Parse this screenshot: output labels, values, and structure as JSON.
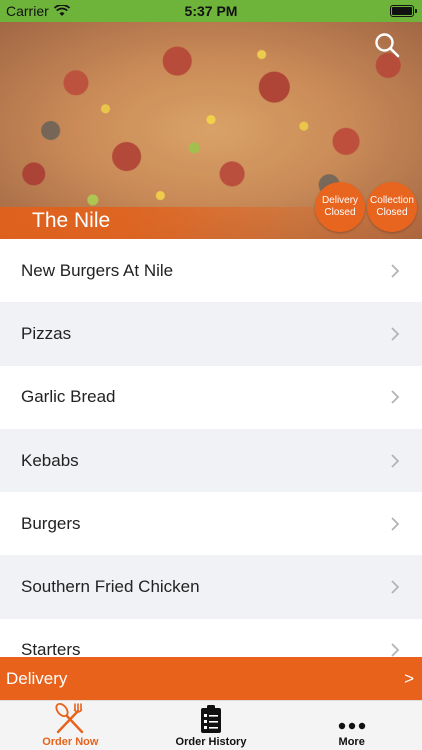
{
  "status_bar": {
    "carrier": "Carrier",
    "time": "5:37 PM",
    "battery_level": 1.0
  },
  "hero": {
    "restaurant_name": "The Nile",
    "delivery_badge": {
      "line1": "Delivery",
      "line2": "Closed"
    },
    "collection_badge": {
      "line1": "Collection",
      "line2": "Closed"
    }
  },
  "categories": [
    {
      "label": "New Burgers At Nile"
    },
    {
      "label": "Pizzas"
    },
    {
      "label": "Garlic Bread"
    },
    {
      "label": "Kebabs"
    },
    {
      "label": "Burgers"
    },
    {
      "label": "Southern Fried Chicken"
    },
    {
      "label": "Starters"
    }
  ],
  "delivery_bar": {
    "label": "Delivery",
    "arrow": ">"
  },
  "tab_bar": {
    "tabs": [
      {
        "label": "Order Now",
        "icon": "fork-knife-icon",
        "active": true
      },
      {
        "label": "Order History",
        "icon": "clipboard-icon",
        "active": false
      },
      {
        "label": "More",
        "icon": "more-dots-icon",
        "active": false
      }
    ]
  },
  "colors": {
    "accent": "#e8621c",
    "status_bar": "#6fb43a",
    "row_alt": "#f1f2f5"
  }
}
